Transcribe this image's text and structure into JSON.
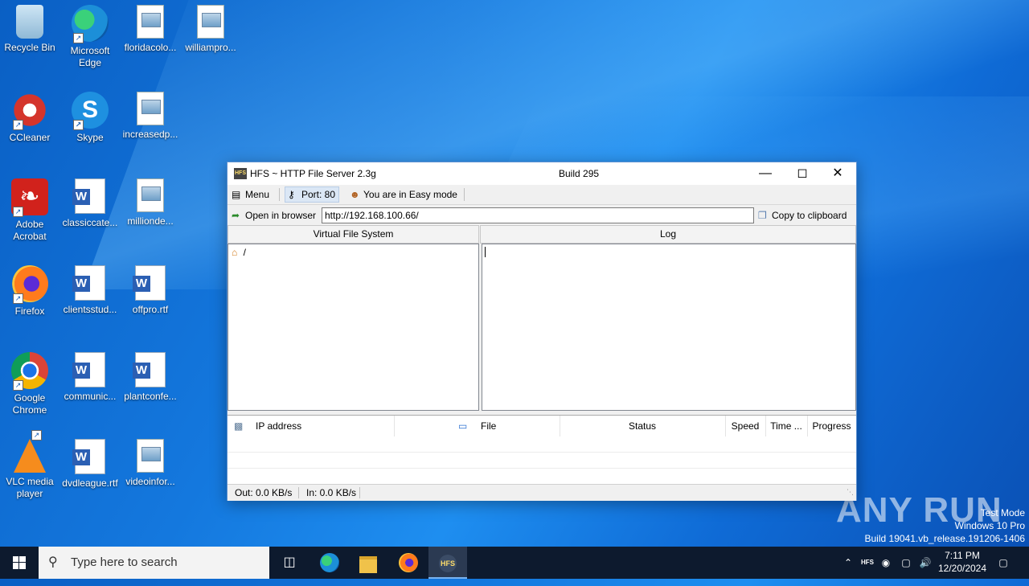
{
  "desktop": {
    "icons": [
      {
        "label": "Recycle Bin",
        "icon": "recycle-bin-icon"
      },
      {
        "label": "Microsoft Edge",
        "icon": "edge-icon"
      },
      {
        "label": "floridacolo...",
        "icon": "image-file-icon"
      },
      {
        "label": "williampro...",
        "icon": "image-file-icon"
      },
      {
        "label": "CCleaner",
        "icon": "ccleaner-icon"
      },
      {
        "label": "Skype",
        "icon": "skype-icon"
      },
      {
        "label": "increasedp...",
        "icon": "image-file-icon"
      },
      {
        "label": "Adobe Acrobat",
        "icon": "acrobat-icon"
      },
      {
        "label": "classiccate...",
        "icon": "word-doc-icon"
      },
      {
        "label": "millionde...",
        "icon": "image-file-icon"
      },
      {
        "label": "Firefox",
        "icon": "firefox-icon"
      },
      {
        "label": "clientsstud...",
        "icon": "word-doc-icon"
      },
      {
        "label": "offpro.rtf",
        "icon": "word-doc-icon"
      },
      {
        "label": "Google Chrome",
        "icon": "chrome-icon"
      },
      {
        "label": "communic...",
        "icon": "word-doc-icon"
      },
      {
        "label": "plantconfe...",
        "icon": "word-doc-icon"
      },
      {
        "label": "VLC media player",
        "icon": "vlc-icon"
      },
      {
        "label": "dvdleague.rtf",
        "icon": "word-doc-icon"
      },
      {
        "label": "videoinfor...",
        "icon": "image-file-icon"
      }
    ]
  },
  "window": {
    "title": "HFS ~ HTTP File Server 2.3g",
    "build": "Build 295",
    "toolbar": {
      "menu": "Menu",
      "port": "Port: 80",
      "mode": "You are in Easy mode"
    },
    "urlbar": {
      "open_browser": "Open in browser",
      "url": "http://192.168.100.66/",
      "copy": "Copy to clipboard"
    },
    "panes": {
      "vfs_header": "Virtual File System",
      "log_header": "Log",
      "vfs_root": "/"
    },
    "grid": {
      "columns": [
        "IP address",
        "File",
        "Status",
        "Speed",
        "Time ...",
        "Progress"
      ]
    },
    "status": {
      "out": "Out: 0.0 KB/s",
      "in": "In: 0.0 KB/s"
    }
  },
  "taskbar": {
    "search_placeholder": "Type here to search",
    "time": "7:11 PM",
    "date": "12/20/2024"
  },
  "watermark": {
    "line1": "Test Mode",
    "line2": "Windows 10 Pro",
    "line3": "Build 19041.vb_release.191206-1406",
    "brand": "ANY RUN"
  },
  "colors": {
    "desktop_blue": "#1478de",
    "taskbar": "#0d1a2e",
    "window_border": "#5a8fd0"
  }
}
